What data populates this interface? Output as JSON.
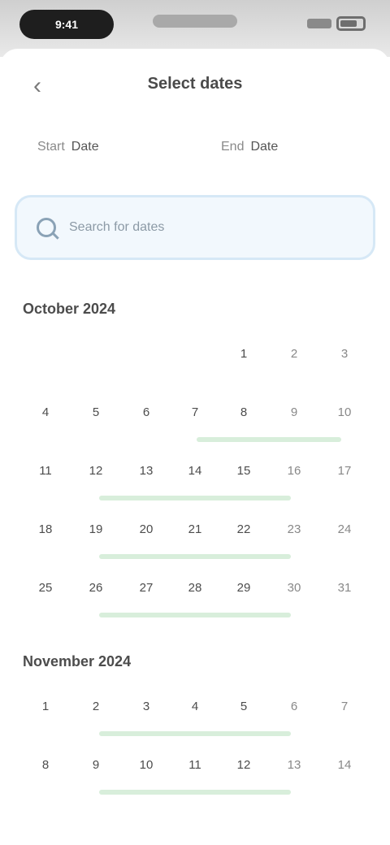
{
  "status_bar": {
    "time": "9:41"
  },
  "header": {
    "back_icon": "chevron-left-icon",
    "title": "Select dates"
  },
  "date_fields": {
    "start_label": "Start",
    "start_value": "Date",
    "end_label": "End",
    "end_value": "Date"
  },
  "search": {
    "placeholder": "Search for dates",
    "value": ""
  },
  "colors": {
    "accent": "#d6e8f6",
    "range_highlight": "#d8eedb"
  },
  "calendar": {
    "months": [
      {
        "title": "October 2024",
        "weeks": [
          [
            "",
            "",
            "",
            "",
            "1",
            "2",
            "3"
          ],
          [
            "4",
            "5",
            "6",
            "7",
            "8",
            "9",
            "10"
          ],
          [
            "11",
            "12",
            "13",
            "14",
            "15",
            "16",
            "17"
          ],
          [
            "18",
            "19",
            "20",
            "21",
            "22",
            "23",
            "24"
          ],
          [
            "25",
            "26",
            "27",
            "28",
            "29",
            "30",
            "31"
          ]
        ]
      },
      {
        "title": "November 2024",
        "weeks": [
          [
            "1",
            "2",
            "3",
            "4",
            "5",
            "6",
            "7"
          ],
          [
            "8",
            "9",
            "10",
            "11",
            "12",
            "13",
            "14"
          ]
        ]
      }
    ]
  }
}
